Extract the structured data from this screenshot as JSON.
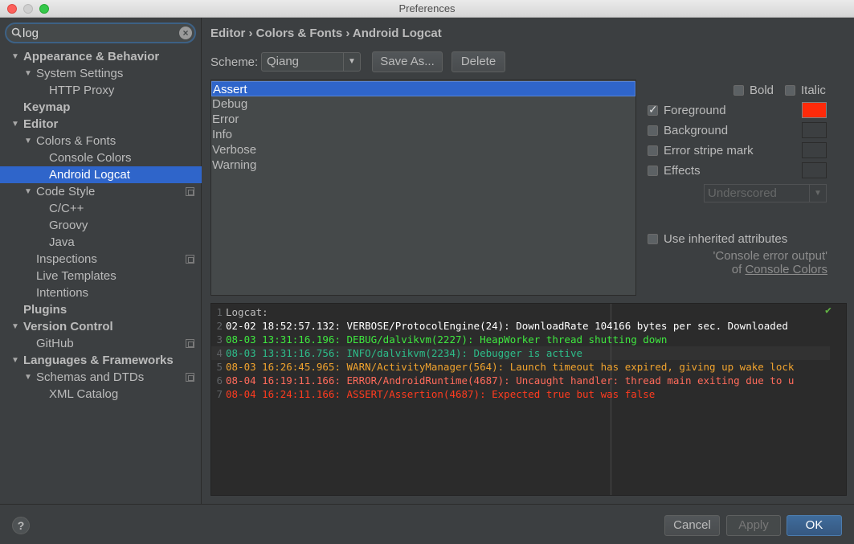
{
  "window": {
    "title": "Preferences"
  },
  "search": {
    "value": "log",
    "icon": "search-icon"
  },
  "tree": [
    {
      "label": "Appearance & Behavior",
      "level": 0,
      "expanded": true,
      "bold": true
    },
    {
      "label": "System Settings",
      "level": 1,
      "expanded": true
    },
    {
      "label": "HTTP Proxy",
      "level": 2
    },
    {
      "label": "Keymap",
      "level": 0,
      "bold": true
    },
    {
      "label": "Editor",
      "level": 0,
      "expanded": true,
      "bold": true
    },
    {
      "label": "Colors & Fonts",
      "level": 1,
      "expanded": true
    },
    {
      "label": "Console Colors",
      "level": 2
    },
    {
      "label": "Android Logcat",
      "level": 2,
      "selected": true
    },
    {
      "label": "Code Style",
      "level": 1,
      "expanded": true,
      "project": true
    },
    {
      "label": "C/C++",
      "level": 2
    },
    {
      "label": "Groovy",
      "level": 2
    },
    {
      "label": "Java",
      "level": 2
    },
    {
      "label": "Inspections",
      "level": 1,
      "project": true
    },
    {
      "label": "Live Templates",
      "level": 1
    },
    {
      "label": "Intentions",
      "level": 1
    },
    {
      "label": "Plugins",
      "level": 0,
      "bold": true
    },
    {
      "label": "Version Control",
      "level": 0,
      "expanded": true,
      "bold": true
    },
    {
      "label": "GitHub",
      "level": 1,
      "project": true
    },
    {
      "label": "Languages & Frameworks",
      "level": 0,
      "expanded": true,
      "bold": true
    },
    {
      "label": "Schemas and DTDs",
      "level": 1,
      "expanded": true,
      "project": true
    },
    {
      "label": "XML Catalog",
      "level": 2
    }
  ],
  "breadcrumb": "Editor › Colors & Fonts › Android Logcat",
  "scheme": {
    "label": "Scheme:",
    "value": "Qiang",
    "save_as": "Save As...",
    "delete": "Delete"
  },
  "log_levels": [
    "Assert",
    "Debug",
    "Error",
    "Info",
    "Verbose",
    "Warning"
  ],
  "selected_level": "Assert",
  "attributes": {
    "bold": {
      "label": "Bold",
      "checked": false
    },
    "italic": {
      "label": "Italic",
      "checked": false
    },
    "foreground": {
      "label": "Foreground",
      "checked": true,
      "color": "#ff2a0a"
    },
    "background": {
      "label": "Background",
      "checked": false
    },
    "error_stripe": {
      "label": "Error stripe mark",
      "checked": false
    },
    "effects": {
      "label": "Effects",
      "checked": false,
      "effect_type": "Underscored"
    },
    "inherited": {
      "label": "Use inherited attributes",
      "checked": false
    },
    "inherit_note_line1": "'Console error output'",
    "inherit_note_of": "of ",
    "inherit_note_link": "Console Colors"
  },
  "preview": [
    {
      "num": "1",
      "text": "Logcat:",
      "color": "#bbbbbb"
    },
    {
      "num": "2",
      "text": "02-02 18:52:57.132: VERBOSE/ProtocolEngine(24): DownloadRate 104166 bytes per sec. Downloaded",
      "color": "#ffffff"
    },
    {
      "num": "3",
      "text": "08-03 13:31:16.196: DEBUG/dalvikvm(2227): HeapWorker thread shutting down",
      "color": "#3fe83f"
    },
    {
      "num": "4",
      "text": "08-03 13:31:16.756: INFO/dalvikvm(2234): Debugger is active",
      "color": "#2dbd8a"
    },
    {
      "num": "5",
      "text": "08-03 16:26:45.965: WARN/ActivityManager(564): Launch timeout has expired, giving up wake lock",
      "color": "#f0a32e"
    },
    {
      "num": "6",
      "text": "08-04 16:19:11.166: ERROR/AndroidRuntime(4687): Uncaught handler: thread main exiting due to u",
      "color": "#ff6b5b"
    },
    {
      "num": "7",
      "text": "08-04 16:24:11.166: ASSERT/Assertion(4687): Expected true but was false",
      "color": "#ff3b1f"
    }
  ],
  "buttons": {
    "help": "?",
    "cancel": "Cancel",
    "apply": "Apply",
    "ok": "OK"
  },
  "colors": {
    "accent": "#2f65ca",
    "background": "#3c3f41",
    "editor_bg": "#2b2b2b"
  }
}
